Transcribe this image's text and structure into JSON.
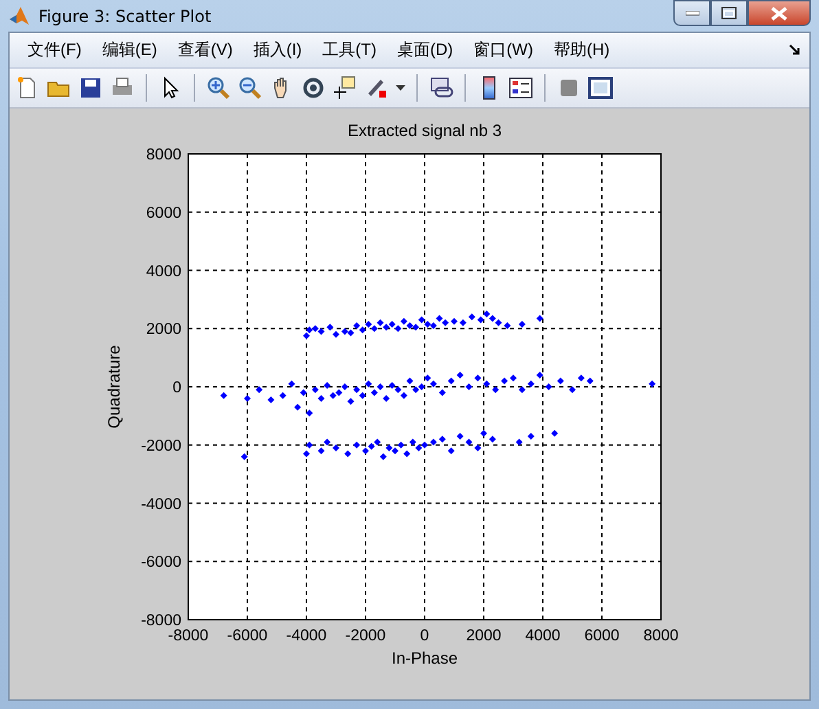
{
  "window": {
    "title": "Figure 3: Scatter Plot"
  },
  "menu": [
    "文件(F)",
    "编辑(E)",
    "查看(V)",
    "插入(I)",
    "工具(T)",
    "桌面(D)",
    "窗口(W)",
    "帮助(H)"
  ],
  "figure": {
    "chart_data": {
      "type": "scatter",
      "grid": true,
      "title": "Extracted signal nb 3",
      "xlabel": "In-Phase",
      "ylabel": "Quadrature",
      "xlim": [
        -8000,
        8000
      ],
      "ylim": [
        -8000,
        8000
      ],
      "xticks": [
        -8000,
        -6000,
        -4000,
        -2000,
        0,
        2000,
        4000,
        6000,
        8000
      ],
      "yticks": [
        -8000,
        -6000,
        -4000,
        -2000,
        0,
        2000,
        4000,
        6000,
        8000
      ],
      "x": [
        -4000,
        -3900,
        -3700,
        -3500,
        -3200,
        -3000,
        -2700,
        -2500,
        -2300,
        -2100,
        -1900,
        -1700,
        -1500,
        -1300,
        -1100,
        -900,
        -700,
        -500,
        -300,
        -100,
        100,
        300,
        500,
        700,
        1000,
        1300,
        1600,
        1900,
        2100,
        2300,
        2500,
        2800,
        3300,
        3900,
        -6800,
        -6000,
        -5600,
        -5200,
        -4800,
        -4500,
        -4300,
        -4100,
        -3900,
        -3700,
        -3500,
        -3300,
        -3100,
        -2900,
        -2700,
        -2500,
        -2300,
        -2100,
        -1900,
        -1700,
        -1500,
        -1300,
        -1100,
        -900,
        -700,
        -500,
        -300,
        -100,
        100,
        300,
        600,
        900,
        1200,
        1500,
        1800,
        2100,
        2400,
        2700,
        3000,
        3300,
        3600,
        3900,
        4200,
        4600,
        5000,
        5300,
        5600,
        7700,
        -6100,
        -4000,
        -3900,
        -3500,
        -3300,
        -3000,
        -2600,
        -2300,
        -2000,
        -1800,
        -1600,
        -1400,
        -1200,
        -1000,
        -800,
        -600,
        -400,
        -200,
        0,
        300,
        600,
        900,
        1200,
        1500,
        1800,
        2000,
        2300,
        3200,
        3600,
        4400
      ],
      "series": [
        {
          "color": "#0000ff",
          "values": [
            1750,
            1950,
            2000,
            1900,
            2050,
            1800,
            1900,
            1850,
            2100,
            1950,
            2150,
            2000,
            2200,
            2050,
            2150,
            2000,
            2250,
            2100,
            2050,
            2300,
            2150,
            2100,
            2350,
            2200,
            2250,
            2200,
            2400,
            2300,
            2500,
            2350,
            2200,
            2100,
            2150,
            2350,
            -300,
            -400,
            -100,
            -450,
            -300,
            100,
            -700,
            -200,
            -900,
            -100,
            -400,
            50,
            -300,
            -200,
            0,
            -500,
            -100,
            -300,
            100,
            -200,
            0,
            -400,
            50,
            -100,
            -300,
            200,
            -100,
            0,
            300,
            100,
            -200,
            200,
            400,
            0,
            300,
            100,
            -100,
            200,
            300,
            -100,
            100,
            400,
            0,
            200,
            -100,
            300,
            200,
            100,
            -2400,
            -2300,
            -2000,
            -2200,
            -1900,
            -2100,
            -2300,
            -2000,
            -2200,
            -2050,
            -1900,
            -2400,
            -2100,
            -2200,
            -2000,
            -2300,
            -1900,
            -2100,
            -2000,
            -1900,
            -1800,
            -2200,
            -1700,
            -1900,
            -2100,
            -1600,
            -1800,
            -1900,
            -1700,
            -1600
          ]
        }
      ]
    }
  }
}
